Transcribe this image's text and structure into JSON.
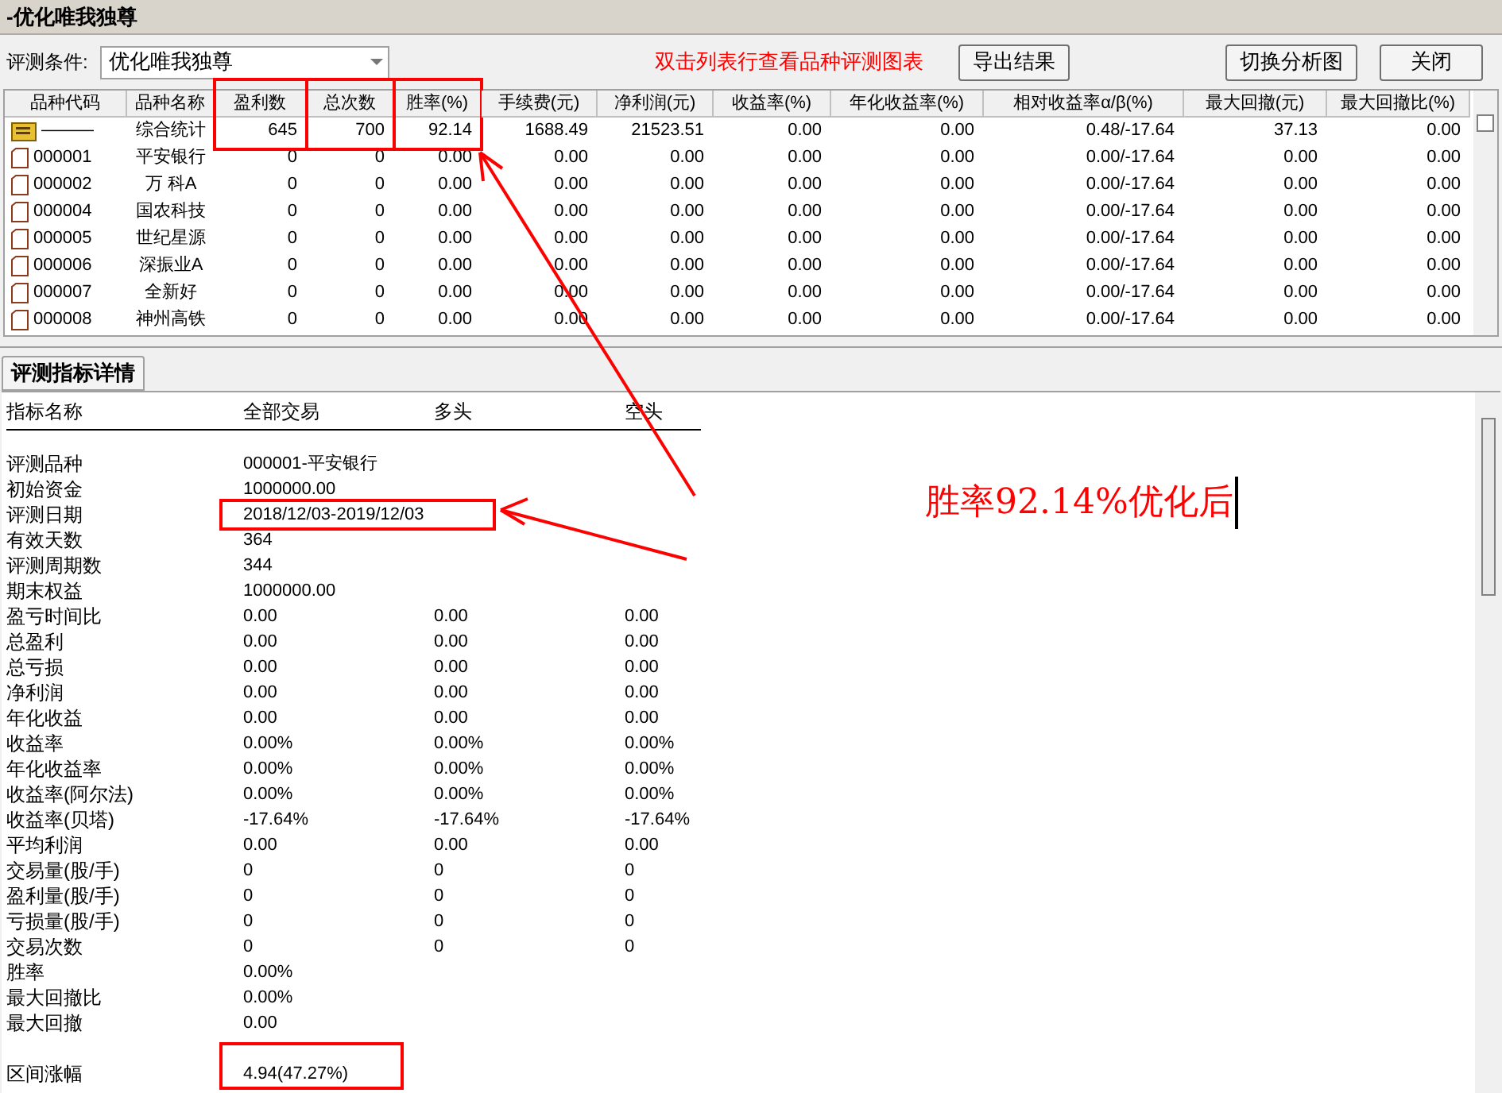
{
  "window": {
    "title": "-优化唯我独尊"
  },
  "toolbar": {
    "condition_label": "评测条件:",
    "condition_value": "优化唯我独尊",
    "hint": "双击列表行查看品种评测图表",
    "buttons": [
      {
        "label": "导出结果"
      },
      {
        "label": "切换分析图"
      },
      {
        "label": "关闭"
      }
    ]
  },
  "table": {
    "columns": [
      {
        "label": "品种代码",
        "boxed": false
      },
      {
        "label": "品种名称",
        "boxed": false
      },
      {
        "label": "盈利数",
        "boxed": true
      },
      {
        "label": "总次数",
        "boxed": true
      },
      {
        "label": "胜率(%)",
        "boxed": true
      },
      {
        "label": "手续费(元)",
        "boxed": false
      },
      {
        "label": "净利润(元)",
        "boxed": false
      },
      {
        "label": "收益率(%)",
        "boxed": false
      },
      {
        "label": "年化收益率(%)",
        "boxed": false
      },
      {
        "label": "相对收益率α/β(%)",
        "boxed": false
      },
      {
        "label": "最大回撤(元)",
        "boxed": false
      },
      {
        "label": "最大回撤比(%)",
        "boxed": false
      }
    ],
    "rows": [
      {
        "kind": "summary",
        "cells": [
          "———",
          "综合统计",
          "645",
          "700",
          "92.14",
          "1688.49",
          "21523.51",
          "0.00",
          "0.00",
          "0.48/-17.64",
          "37.13",
          "0.00"
        ]
      },
      {
        "kind": "stock",
        "cells": [
          "000001",
          "平安银行",
          "0",
          "0",
          "0.00",
          "0.00",
          "0.00",
          "0.00",
          "0.00",
          "0.00/-17.64",
          "0.00",
          "0.00"
        ]
      },
      {
        "kind": "stock",
        "cells": [
          "000002",
          "万 科A",
          "0",
          "0",
          "0.00",
          "0.00",
          "0.00",
          "0.00",
          "0.00",
          "0.00/-17.64",
          "0.00",
          "0.00"
        ]
      },
      {
        "kind": "stock",
        "cells": [
          "000004",
          "国农科技",
          "0",
          "0",
          "0.00",
          "0.00",
          "0.00",
          "0.00",
          "0.00",
          "0.00/-17.64",
          "0.00",
          "0.00"
        ]
      },
      {
        "kind": "stock",
        "cells": [
          "000005",
          "世纪星源",
          "0",
          "0",
          "0.00",
          "0.00",
          "0.00",
          "0.00",
          "0.00",
          "0.00/-17.64",
          "0.00",
          "0.00"
        ]
      },
      {
        "kind": "stock",
        "cells": [
          "000006",
          "深振业A",
          "0",
          "0",
          "0.00",
          "0.00",
          "0.00",
          "0.00",
          "0.00",
          "0.00/-17.64",
          "0.00",
          "0.00"
        ]
      },
      {
        "kind": "stock",
        "cells": [
          "000007",
          "全新好",
          "0",
          "0",
          "0.00",
          "0.00",
          "0.00",
          "0.00",
          "0.00",
          "0.00/-17.64",
          "0.00",
          "0.00"
        ]
      },
      {
        "kind": "stock",
        "cells": [
          "000008",
          "神州高铁",
          "0",
          "0",
          "0.00",
          "0.00",
          "0.00",
          "0.00",
          "0.00",
          "0.00/-17.64",
          "0.00",
          "0.00"
        ]
      }
    ]
  },
  "detail": {
    "tab": {
      "label": "评测指标详情",
      "selected": true
    },
    "columns": [
      "指标名称",
      "全部交易",
      "多头",
      "空头"
    ],
    "rows": [
      {
        "label": "评测品种",
        "values": [
          "000001-平安银行"
        ],
        "boxed": false
      },
      {
        "label": "初始资金",
        "values": [
          "1000000.00"
        ],
        "boxed": false
      },
      {
        "label": "评测日期",
        "values": [
          "2018/12/03-2019/12/03"
        ],
        "boxed": true
      },
      {
        "label": "有效天数",
        "values": [
          "364"
        ],
        "boxed": false
      },
      {
        "label": "评测周期数",
        "values": [
          "344"
        ],
        "boxed": false
      },
      {
        "label": "期末权益",
        "values": [
          "1000000.00"
        ],
        "boxed": false
      },
      {
        "label": "盈亏时间比",
        "values": [
          "0.00",
          "0.00",
          "0.00"
        ],
        "boxed": false
      },
      {
        "label": "总盈利",
        "values": [
          "0.00",
          "0.00",
          "0.00"
        ],
        "boxed": false
      },
      {
        "label": "总亏损",
        "values": [
          "0.00",
          "0.00",
          "0.00"
        ],
        "boxed": false
      },
      {
        "label": "净利润",
        "values": [
          "0.00",
          "0.00",
          "0.00"
        ],
        "boxed": false
      },
      {
        "label": "年化收益",
        "values": [
          "0.00",
          "0.00",
          "0.00"
        ],
        "boxed": false
      },
      {
        "label": "收益率",
        "values": [
          "0.00%",
          "0.00%",
          "0.00%"
        ],
        "boxed": false
      },
      {
        "label": "年化收益率",
        "values": [
          "0.00%",
          "0.00%",
          "0.00%"
        ],
        "boxed": false
      },
      {
        "label": "收益率(阿尔法)",
        "values": [
          "0.00%",
          "0.00%",
          "0.00%"
        ],
        "boxed": false
      },
      {
        "label": "收益率(贝塔)",
        "values": [
          "-17.64%",
          "-17.64%",
          "-17.64%"
        ],
        "boxed": false
      },
      {
        "label": "平均利润",
        "values": [
          "0.00",
          "0.00",
          "0.00"
        ],
        "boxed": false
      },
      {
        "label": "交易量(股/手)",
        "values": [
          "0",
          "0",
          "0"
        ],
        "boxed": false
      },
      {
        "label": "盈利量(股/手)",
        "values": [
          "0",
          "0",
          "0"
        ],
        "boxed": false
      },
      {
        "label": "亏损量(股/手)",
        "values": [
          "0",
          "0",
          "0"
        ],
        "boxed": false
      },
      {
        "label": "交易次数",
        "values": [
          "0",
          "0",
          "0"
        ],
        "boxed": false
      },
      {
        "label": "胜率",
        "values": [
          "0.00%"
        ],
        "boxed": false
      },
      {
        "label": "最大回撤比",
        "values": [
          "0.00%"
        ],
        "boxed": false
      },
      {
        "label": "最大回撤",
        "values": [
          "0.00"
        ],
        "boxed": false
      },
      {
        "label": "区间涨幅",
        "values": [
          "4.94(47.27%)"
        ],
        "boxed": true
      }
    ]
  },
  "annotation": {
    "text": "胜率92.14%优化后"
  }
}
